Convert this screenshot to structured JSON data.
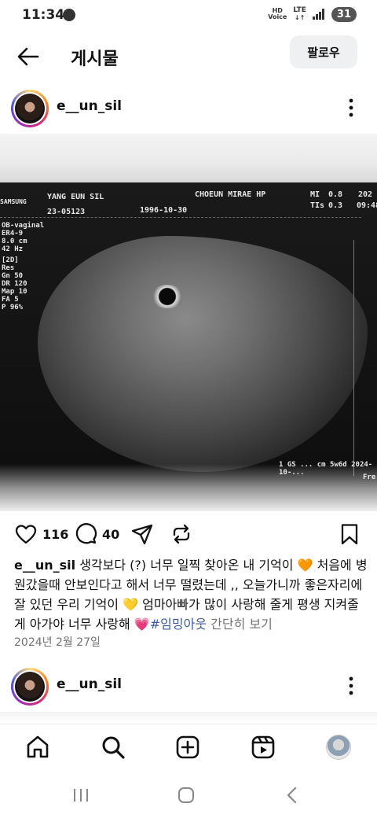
{
  "status_bar": {
    "time": "11:34",
    "hd_label": "HD",
    "voice_label": "Voice",
    "network": "LTE",
    "battery": "31"
  },
  "header": {
    "title": "게시물",
    "follow_label": "팔로우",
    "icons": {
      "back": "arrow-left-icon"
    }
  },
  "post": {
    "username": "e__un_sil",
    "photo_text": {
      "brand": "SAMSUNG",
      "patient": "YANG EUN SIL",
      "id": "23-05123",
      "dob": "1996-10-30",
      "hospital": "CHOEUN MIRAE HP",
      "mi_label": "MI",
      "mi_value": "0.8",
      "tis_label": "TIs",
      "tis_value": "0.3",
      "corner_date": "202",
      "corner_time": "09:48",
      "probe": "OB-vaginal",
      "probe_model": "ER4-9",
      "depth": "8.0 cm",
      "freq": "42 Hz",
      "mode": "[2D]",
      "res": "Res",
      "gn": "Gn  50",
      "dr": "DR  120",
      "map": "Map 10",
      "fa": "FA   5",
      "p": "P    96%",
      "footer": "1 GS ... cm 5w6d  2024-10-...",
      "footer_right": "Fre"
    },
    "likes": "116",
    "comments": "40",
    "caption_user": "e__un_sil",
    "caption_part1": " 생각보다 (?) 너무 일찍 찾아온 내 기억이 ",
    "emoji_orange_heart": "🧡",
    "caption_part2": " 처음에 병원갔을때 안보인다고 해서 너무 떨렸는데 ,, 오늘가니까 좋은자리에 잘 있던 우리 기억이 ",
    "emoji_yellow_heart": "💛",
    "caption_part3": " 엄마아빠가 많이 사랑해 줄게 평생 지켜줄게 아가야 너무 사랑해 ",
    "emoji_pink_heart": "💗",
    "hashtag": "#임밍아웃",
    "more_label": " 간단히 보기",
    "date": "2024년 2월 27일"
  },
  "next_post": {
    "username": "e__un_sil"
  },
  "bottom_nav": {
    "items": [
      "home-icon",
      "search-icon",
      "create-post-icon",
      "reels-icon",
      "profile-avatar"
    ]
  },
  "colors": {
    "accent_link": "#3d5a9e",
    "muted": "#737373",
    "follow_bg": "#eef0f2"
  }
}
